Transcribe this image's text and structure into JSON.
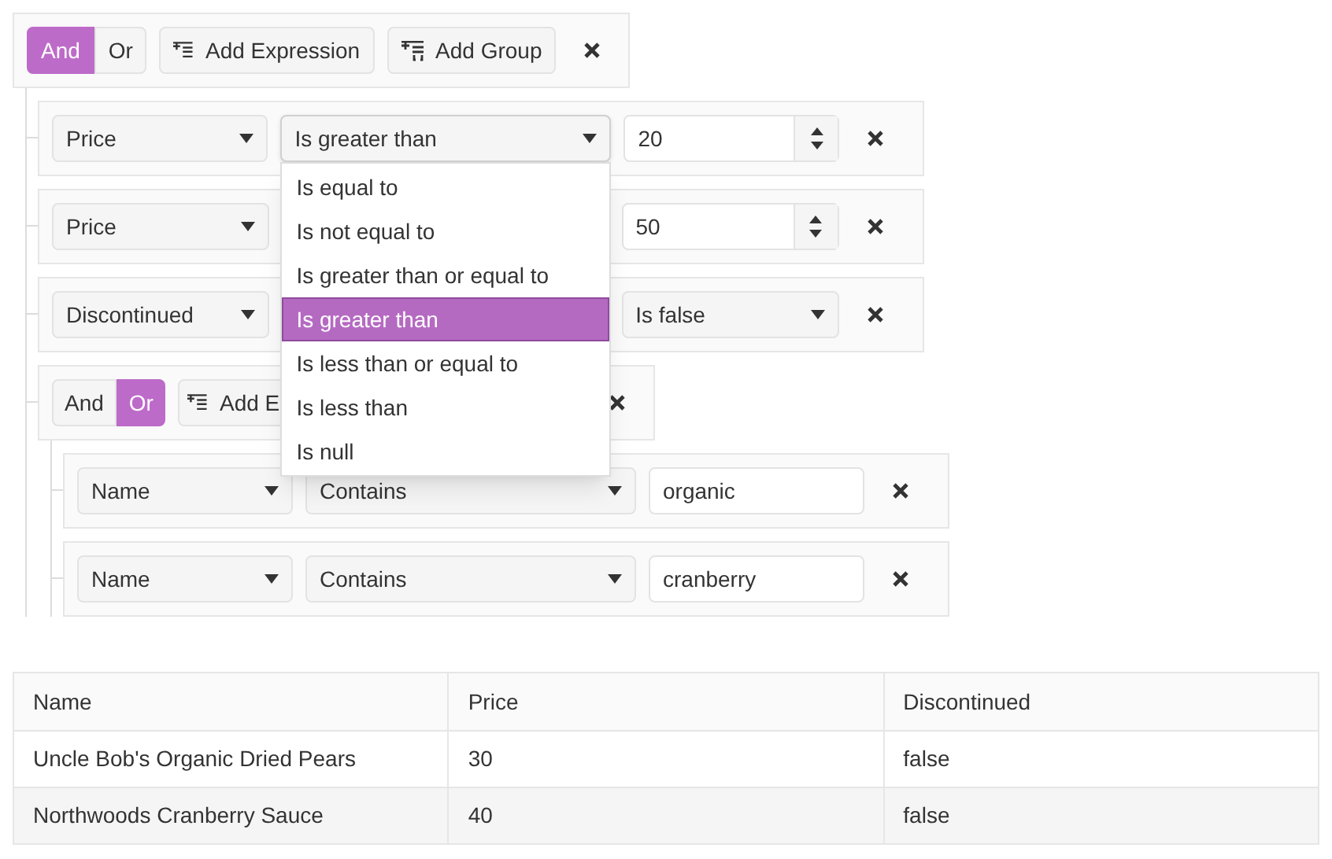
{
  "filter": {
    "logic": [
      {
        "label": "And",
        "selected": true
      },
      {
        "label": "Or",
        "selected": false
      }
    ],
    "add_expression": "Add Expression",
    "add_group": "Add Group",
    "children": [
      {
        "kind": "expression",
        "field": "Price",
        "operator": "Is greater than",
        "value": {
          "kind": "numeric",
          "text": "20"
        },
        "operator_open": true,
        "operator_options": [
          {
            "label": "Is equal to",
            "selected": false
          },
          {
            "label": "Is not equal to",
            "selected": false
          },
          {
            "label": "Is greater than or equal to",
            "selected": false
          },
          {
            "label": "Is greater than",
            "selected": true
          },
          {
            "label": "Is less than or equal to",
            "selected": false
          },
          {
            "label": "Is less than",
            "selected": false
          },
          {
            "label": "Is null",
            "selected": false
          }
        ]
      },
      {
        "kind": "expression",
        "field": "Price",
        "value": {
          "kind": "numeric",
          "text": "50"
        }
      },
      {
        "kind": "expression",
        "field": "Discontinued",
        "value": {
          "kind": "dropdown",
          "text": "Is false"
        }
      },
      {
        "kind": "group",
        "logic": [
          {
            "label": "And",
            "selected": false
          },
          {
            "label": "Or",
            "selected": true
          }
        ],
        "add_expression": "Add E",
        "children": [
          {
            "kind": "expression",
            "field": "Name",
            "operator": "Contains",
            "value": {
              "kind": "text",
              "text": "organic"
            }
          },
          {
            "kind": "expression",
            "field": "Name",
            "operator": "Contains",
            "value": {
              "kind": "text",
              "text": "cranberry"
            }
          }
        ]
      }
    ]
  },
  "table": {
    "columns": [
      "Name",
      "Price",
      "Discontinued"
    ],
    "rows": [
      [
        "Uncle Bob's Organic Dried Pears",
        "30",
        "false"
      ],
      [
        "Northwoods Cranberry Sauce",
        "40",
        "false"
      ]
    ]
  }
}
